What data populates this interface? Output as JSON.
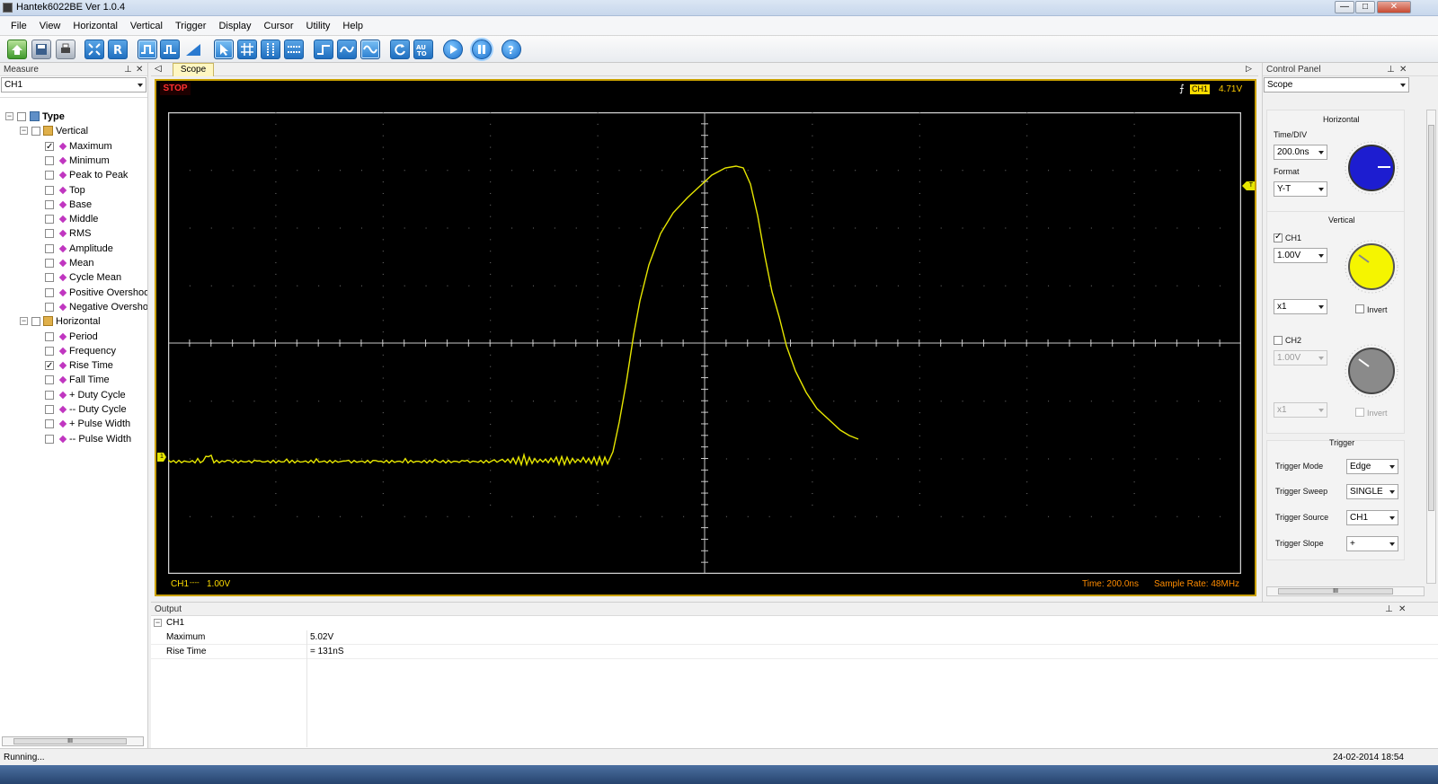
{
  "window": {
    "title": "Hantek6022BE Ver 1.0.4"
  },
  "menu": [
    "File",
    "View",
    "Horizontal",
    "Vertical",
    "Trigger",
    "Display",
    "Cursor",
    "Utility",
    "Help"
  ],
  "toolbar_icons": [
    "open-icon",
    "save-icon",
    "print-icon",
    "auto-scale-icon",
    "reset-icon",
    "square-wave-icon",
    "pulse-icon",
    "ramp-icon",
    "cursor-select-icon",
    "grid-icon",
    "vertical-cursor-icon",
    "horizontal-cursor-icon",
    "step-icon",
    "sine-icon",
    "wave-icon",
    "refresh-icon",
    "auto-icon",
    "play-icon",
    "pause-icon",
    "help-icon"
  ],
  "measure": {
    "title": "Measure",
    "channel": "CH1",
    "tree": {
      "root": "Type",
      "vertical": {
        "label": "Vertical",
        "items": [
          {
            "label": "Maximum",
            "checked": true
          },
          {
            "label": "Minimum",
            "checked": false
          },
          {
            "label": "Peak to Peak",
            "checked": false
          },
          {
            "label": "Top",
            "checked": false
          },
          {
            "label": "Base",
            "checked": false
          },
          {
            "label": "Middle",
            "checked": false
          },
          {
            "label": "RMS",
            "checked": false
          },
          {
            "label": "Amplitude",
            "checked": false
          },
          {
            "label": "Mean",
            "checked": false
          },
          {
            "label": "Cycle Mean",
            "checked": false
          },
          {
            "label": "Positive Overshoo",
            "checked": false
          },
          {
            "label": "Negative Oversho",
            "checked": false
          }
        ]
      },
      "horizontal": {
        "label": "Horizontal",
        "items": [
          {
            "label": "Period",
            "checked": false
          },
          {
            "label": "Frequency",
            "checked": false
          },
          {
            "label": "Rise Time",
            "checked": true
          },
          {
            "label": "Fall Time",
            "checked": false
          },
          {
            "label": "+ Duty Cycle",
            "checked": false
          },
          {
            "label": "-- Duty Cycle",
            "checked": false
          },
          {
            "label": "+ Pulse Width",
            "checked": false
          },
          {
            "label": "-- Pulse Width",
            "checked": false
          }
        ]
      }
    },
    "scroll_grip": "III"
  },
  "scope": {
    "tab": "Scope",
    "status": "STOP",
    "trigger_channel": "CH1",
    "trigger_level": "4.71V",
    "ch1_marker": "1",
    "trigger_marker": "T",
    "ch1_label": "CH1",
    "ch1_coupling": "----",
    "ch1_scale": "1.00V",
    "time_label": "Time: 200.0ns",
    "sample_rate": "Sample Rate: 48MHz",
    "colors": {
      "trace": "#e6e600",
      "grid": "#c8c8c8",
      "frame": "#c9a000",
      "status_text": "#ff8c00"
    }
  },
  "control_panel": {
    "title": "Control Panel",
    "mode": "Scope",
    "horizontal": {
      "title": "Horizontal",
      "time_div_label": "Time/DIV",
      "time_div": "200.0ns",
      "format_label": "Format",
      "format": "Y-T"
    },
    "vertical": {
      "title": "Vertical",
      "ch1_label": "CH1",
      "ch1_enabled": true,
      "ch1_volts": "1.00V",
      "ch1_probe": "x1",
      "ch1_invert_label": "Invert",
      "ch2_label": "CH2",
      "ch2_enabled": false,
      "ch2_volts": "1.00V",
      "ch2_probe": "x1",
      "ch2_invert_label": "Invert"
    },
    "trigger": {
      "title": "Trigger",
      "mode_label": "Trigger Mode",
      "mode": "Edge",
      "sweep_label": "Trigger Sweep",
      "sweep": "SINGLE",
      "source_label": "Trigger Source",
      "source": "CH1",
      "slope_label": "Trigger Slope",
      "slope": "+"
    },
    "scroll_grip": "III"
  },
  "output": {
    "title": "Output",
    "channel": "CH1",
    "rows": [
      {
        "name": "Maximum",
        "value": "5.02V"
      },
      {
        "name": "Rise Time",
        "value": "= 131nS"
      }
    ]
  },
  "status": {
    "text": "Running...",
    "datetime": "24-02-2014  18:54"
  }
}
